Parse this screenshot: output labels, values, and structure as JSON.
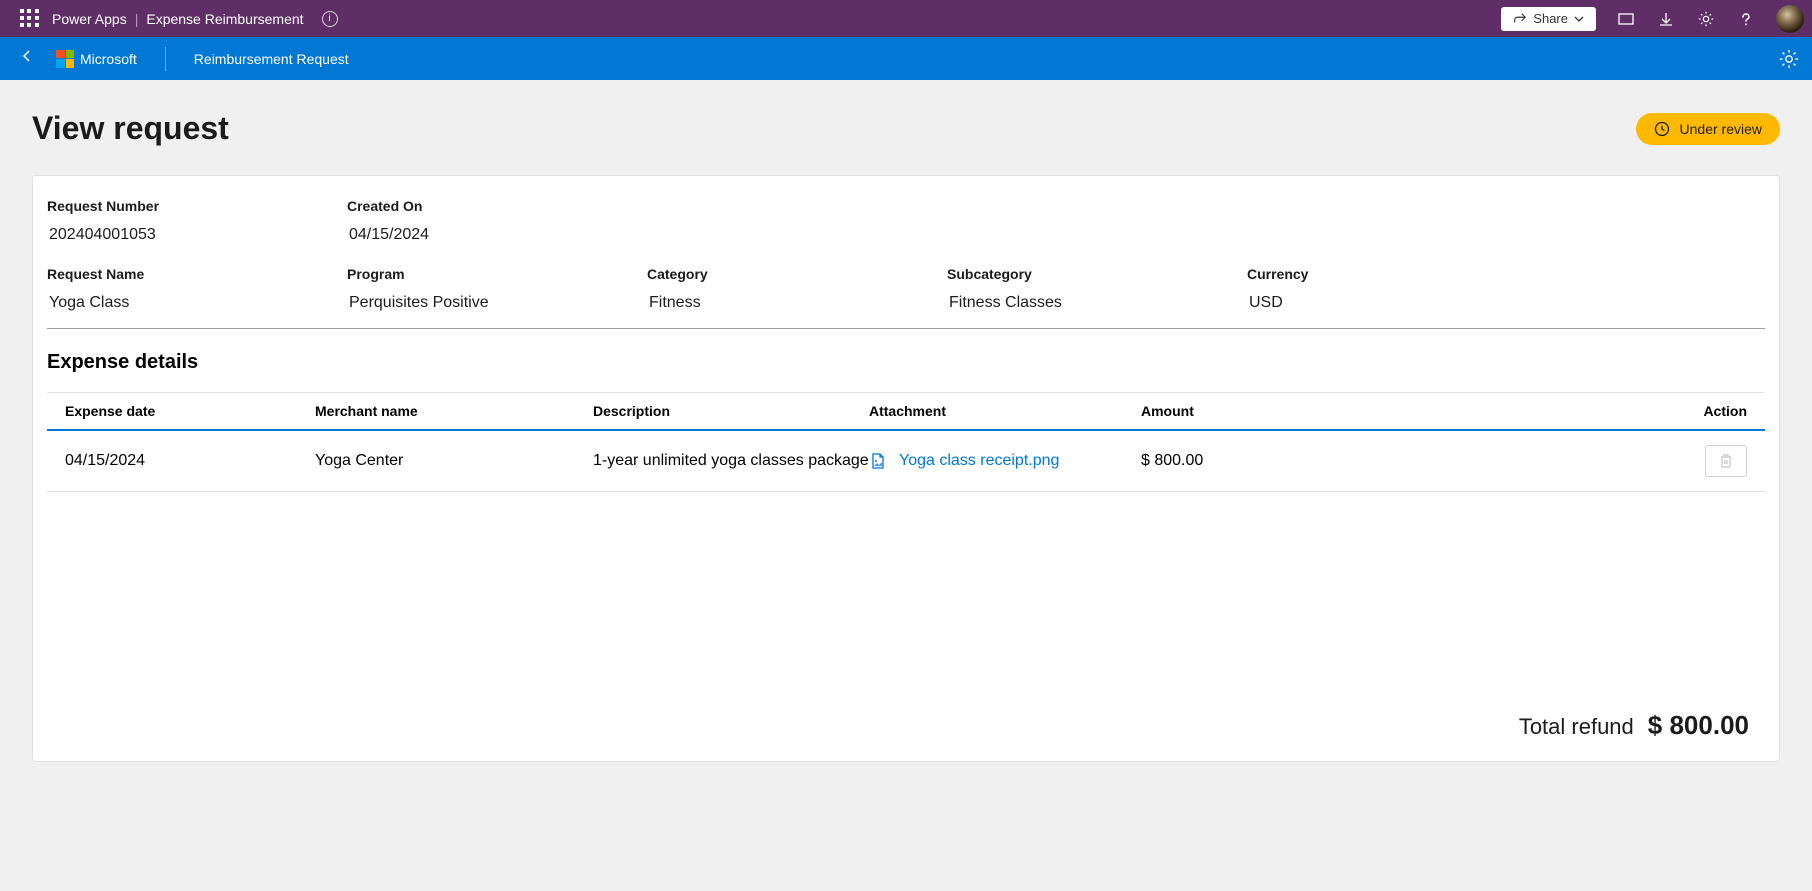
{
  "topBar": {
    "app": "Power Apps",
    "page": "Expense Reimbursement",
    "shareLabel": "Share"
  },
  "appBar": {
    "brand": "Microsoft",
    "title": "Reimbursement Request"
  },
  "page": {
    "title": "View request",
    "statusLabel": "Under review"
  },
  "fields": {
    "requestNumber": {
      "label": "Request Number",
      "value": "202404001053"
    },
    "createdOn": {
      "label": "Created On",
      "value": "04/15/2024"
    },
    "requestName": {
      "label": "Request Name",
      "value": "Yoga Class"
    },
    "program": {
      "label": "Program",
      "value": "Perquisites Positive"
    },
    "category": {
      "label": "Category",
      "value": "Fitness"
    },
    "subcategory": {
      "label": "Subcategory",
      "value": "Fitness Classes"
    },
    "currency": {
      "label": "Currency",
      "value": "USD"
    }
  },
  "expense": {
    "sectionTitle": "Expense details",
    "columns": {
      "date": "Expense date",
      "merchant": "Merchant name",
      "description": "Description",
      "attachment": "Attachment",
      "amount": "Amount",
      "action": "Action"
    },
    "rows": [
      {
        "date": "04/15/2024",
        "merchant": "Yoga Center",
        "description": "1-year unlimited yoga classes package",
        "attachment": "Yoga class receipt.png",
        "amount": "$ 800.00"
      }
    ],
    "totalLabel": "Total refund",
    "totalAmount": "$ 800.00"
  }
}
